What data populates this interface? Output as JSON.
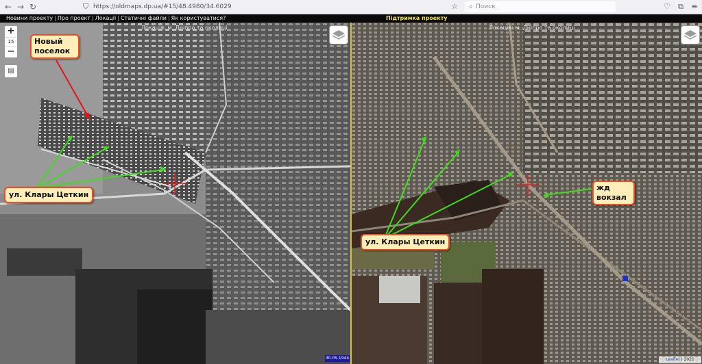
{
  "browser": {
    "url": "https://oldmaps.dp.ua/#15/48.4980/34.6029",
    "search_placeholder": "Поиск"
  },
  "menu": {
    "items": [
      "Новини проекту",
      "Про проект",
      "Локації",
      "Статичні файли",
      "Як користуватися?"
    ],
    "separator": "|",
    "support": "Підтримка проекту"
  },
  "left_map": {
    "location": "Локація: м. Дніпро та околиці",
    "zoom_level": "15",
    "date": "30.05.1944",
    "labels": {
      "new_settlement": "Новый поселок",
      "street": "ул. Клары Цеткин"
    }
  },
  "right_map": {
    "location": "Локація: м. Дніпро та околиці",
    "attribution_leaflet": "Leaflet",
    "attribution_rest": "| 2021 Google",
    "labels": {
      "street": "ул. Клары Цеткин",
      "station": "жд вокзал"
    }
  },
  "colors": {
    "accent_divider": "#d9c23a",
    "callout_bg": "#ffeeb8",
    "callout_border": "#e8522a",
    "arrow_green": "#3fdc1e",
    "arrow_red": "#e01818",
    "support_text": "#f4e64a"
  }
}
